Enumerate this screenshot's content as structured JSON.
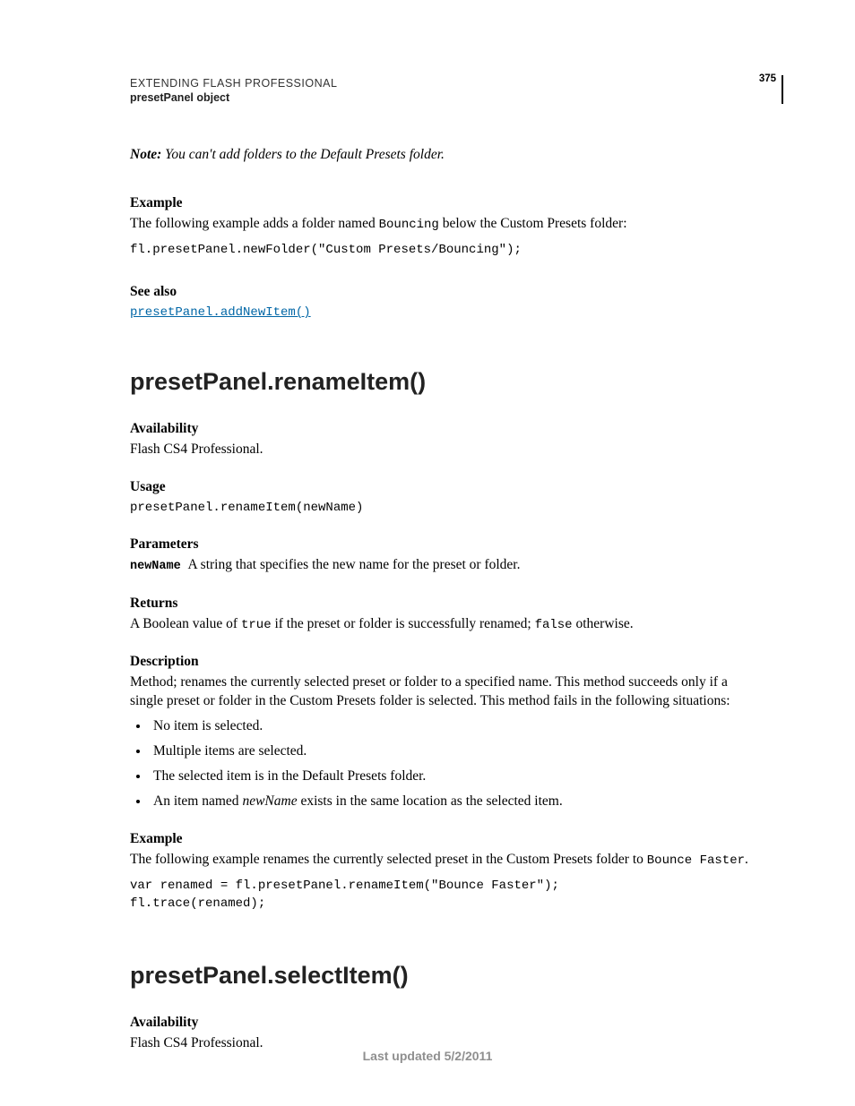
{
  "header": {
    "title": "EXTENDING FLASH PROFESSIONAL",
    "subtitle": "presetPanel object",
    "page_number": "375"
  },
  "note": {
    "label": "Note:",
    "text": "You can't add folders to the Default Presets folder."
  },
  "section1": {
    "example_head": "Example",
    "example_text_before": "The following example adds a folder named ",
    "example_code_inline": "Bouncing",
    "example_text_after": " below the Custom Presets folder:",
    "example_code": "fl.presetPanel.newFolder(\"Custom Presets/Bouncing\");",
    "seealso_head": "See also",
    "seealso_link": "presetPanel.addNewItem()"
  },
  "rename": {
    "title": "presetPanel.renameItem()",
    "availability_head": "Availability",
    "availability_text": "Flash CS4 Professional.",
    "usage_head": "Usage",
    "usage_code": "presetPanel.renameItem(newName)",
    "parameters_head": "Parameters",
    "param_name": "newName",
    "param_text": "A string that specifies the new name for the preset or folder.",
    "returns_head": "Returns",
    "returns_before": "A Boolean value of ",
    "returns_true": "true",
    "returns_mid": " if the preset or folder is successfully renamed; ",
    "returns_false": "false",
    "returns_after": " otherwise.",
    "description_head": "Description",
    "description_text": "Method; renames the currently selected preset or folder to a specified name. This method succeeds only if a single preset or folder in the Custom Presets folder is selected. This method fails in the following situations:",
    "bullets": [
      "No item is selected.",
      "Multiple items are selected.",
      "The selected item is in the Default Presets folder."
    ],
    "bullet4_before": "An item named ",
    "bullet4_italic": "newName",
    "bullet4_after": " exists in the same location as the selected item.",
    "example_head": "Example",
    "example_text_before": "The following example renames the currently selected preset in the Custom Presets folder to ",
    "example_code_inline": "Bounce Faster",
    "example_text_after": ".",
    "example_code": "var renamed = fl.presetPanel.renameItem(\"Bounce Faster\");\nfl.trace(renamed);"
  },
  "select": {
    "title": "presetPanel.selectItem()",
    "availability_head": "Availability",
    "availability_text": "Flash CS4 Professional."
  },
  "footer": "Last updated 5/2/2011"
}
